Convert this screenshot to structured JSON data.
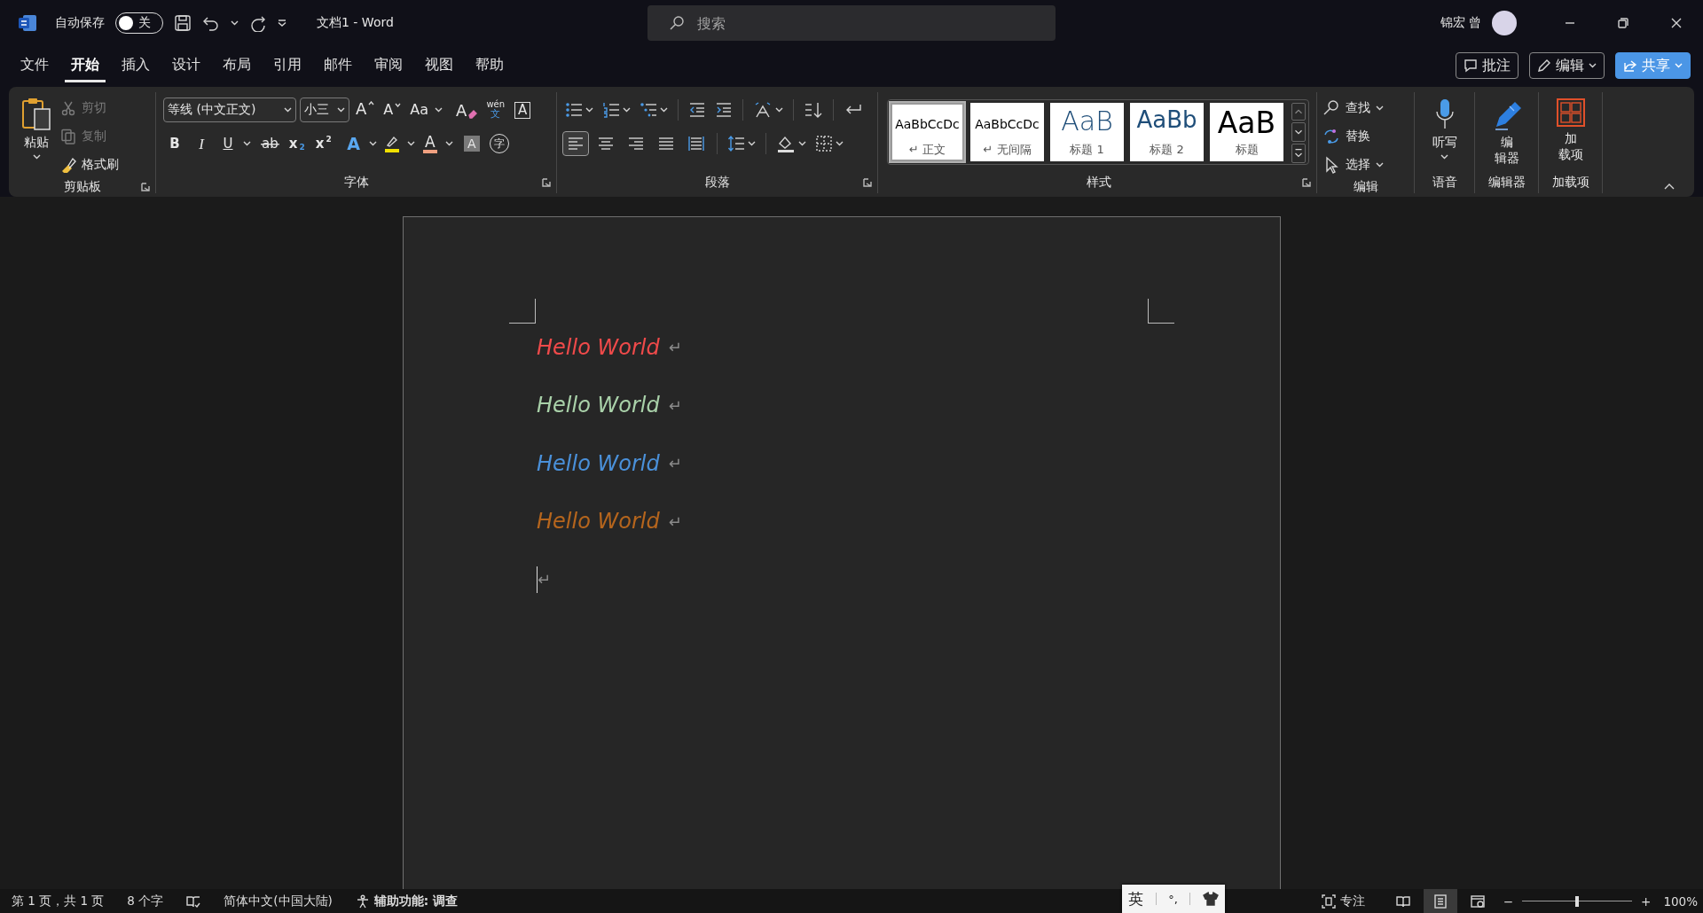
{
  "title_bar": {
    "autosave_label": "自动保存",
    "autosave": {
      "on": false,
      "state_label": "关"
    },
    "document_title": "文档1 - Word",
    "search": {
      "placeholder": "搜索"
    },
    "user_name": "锦宏 曾"
  },
  "ribbon_tabs": [
    {
      "label": "文件",
      "selected": false
    },
    {
      "label": "开始",
      "selected": true
    },
    {
      "label": "插入",
      "selected": false
    },
    {
      "label": "设计",
      "selected": false
    },
    {
      "label": "布局",
      "selected": false
    },
    {
      "label": "引用",
      "selected": false
    },
    {
      "label": "邮件",
      "selected": false
    },
    {
      "label": "审阅",
      "selected": false
    },
    {
      "label": "视图",
      "selected": false
    },
    {
      "label": "帮助",
      "selected": false
    }
  ],
  "tab_actions": [
    {
      "kind": "comments",
      "label": "批注"
    },
    {
      "kind": "editing",
      "label": "编辑"
    },
    {
      "kind": "share",
      "label": "共享"
    }
  ],
  "clipboard": {
    "paste": "粘贴",
    "commands": [
      {
        "kind": "cut",
        "label": "剪切",
        "disabled": true
      },
      {
        "kind": "copy",
        "label": "复制",
        "disabled": true
      },
      {
        "kind": "painter",
        "label": "格式刷",
        "disabled": false
      }
    ],
    "group_label": "剪贴板"
  },
  "font": {
    "font_name": "等线 (中文正文)",
    "font_size": "小三",
    "row1": [
      {
        "kind": "grow",
        "glyph": "A"
      },
      {
        "kind": "shrink",
        "glyph": "A"
      },
      {
        "kind": "case",
        "glyph": "Aa"
      },
      {
        "kind": "clear",
        "glyph": "A"
      },
      {
        "kind": "phonetic",
        "glyph": "wén",
        "sub": "文"
      },
      {
        "kind": "border",
        "glyph": "A"
      }
    ],
    "row2": [
      {
        "kind": "bold",
        "glyph": "B"
      },
      {
        "kind": "italic",
        "glyph": "I"
      },
      {
        "kind": "underline",
        "glyph": "U"
      },
      {
        "kind": "strike",
        "glyph": "ab"
      },
      {
        "kind": "subscript",
        "glyph": "x",
        "sub": "2"
      },
      {
        "kind": "superscript",
        "glyph": "x",
        "sub": "2"
      },
      {
        "kind": "effects",
        "glyph": "A"
      },
      {
        "kind": "highlight"
      },
      {
        "kind": "color",
        "glyph": "A"
      },
      {
        "kind": "shading",
        "glyph": "A"
      },
      {
        "kind": "enclose",
        "glyph": "字"
      }
    ],
    "group_label": "字体"
  },
  "paragraph": {
    "alignment": [
      {
        "kind": "left",
        "selected": true
      },
      {
        "kind": "center",
        "selected": false
      },
      {
        "kind": "right",
        "selected": false
      },
      {
        "kind": "justify",
        "selected": false
      },
      {
        "kind": "distributed",
        "selected": false
      }
    ],
    "group_label": "段落"
  },
  "styles": {
    "items": [
      {
        "kind": "body",
        "preview": "AaBbCcDc",
        "mark": "↵",
        "name": "正文",
        "selected": true
      },
      {
        "kind": "body",
        "preview": "AaBbCcDc",
        "mark": "↵",
        "name": "无间隔",
        "selected": false
      },
      {
        "kind": "heading1",
        "preview": "AaB",
        "name": "标题 1",
        "selected": false
      },
      {
        "kind": "heading2",
        "preview": "AaBb",
        "name": "标题 2",
        "selected": false
      },
      {
        "kind": "title",
        "preview": "AaB",
        "name": "标题",
        "selected": false
      }
    ],
    "group_label": "样式"
  },
  "editing": {
    "commands": [
      {
        "kind": "find",
        "label": "查找"
      },
      {
        "kind": "replace",
        "label": "替换"
      },
      {
        "kind": "select",
        "label": "选择"
      }
    ],
    "group_label": "编辑"
  },
  "voice": {
    "button": "听写",
    "group_label": "语音"
  },
  "editor": {
    "button_lines": [
      "编",
      "辑器"
    ],
    "group_label": "编辑器"
  },
  "addins": {
    "button_lines": [
      "加",
      "载项"
    ],
    "group_label": "加载项"
  },
  "document": {
    "paragraphs": [
      {
        "text": "Hello World",
        "color": "#ef4a4a",
        "mark": "↵"
      },
      {
        "text": "Hello World",
        "color": "#a9d1a9",
        "mark": "↵"
      },
      {
        "text": "Hello World",
        "color": "#4a90d9",
        "mark": "↵"
      },
      {
        "text": "Hello World",
        "color": "#b5651d",
        "mark": "↵"
      }
    ],
    "empty_paragraph_mark": "↵"
  },
  "status_bar": {
    "page": "第 1 页，共 1 页",
    "words": "8 个字",
    "language": "简体中文(中国大陆)",
    "accessibility": "辅助功能: 调查",
    "focus": "专注",
    "views": [
      {
        "kind": "read",
        "selected": false
      },
      {
        "kind": "print",
        "selected": true
      },
      {
        "kind": "web",
        "selected": false
      }
    ],
    "zoom": {
      "minus": "−",
      "plus": "+",
      "level": 0.5,
      "reading": "100%"
    }
  },
  "ime": {
    "mode": "英",
    "punct": "°,"
  }
}
